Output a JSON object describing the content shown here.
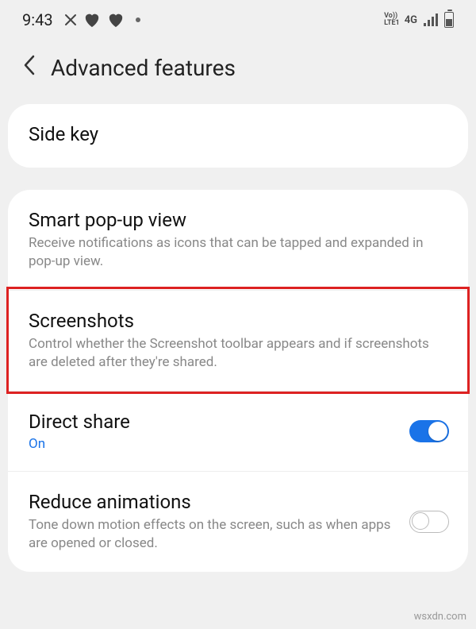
{
  "status": {
    "time": "9:43",
    "volte_top": "Vo))",
    "volte_bottom": "LTE1",
    "net": "4G"
  },
  "header": {
    "title": "Advanced features"
  },
  "card1": {
    "side_key": {
      "title": "Side key"
    }
  },
  "card2": {
    "smart_popup": {
      "title": "Smart pop-up view",
      "desc": "Receive notifications as icons that can be tapped and expanded in pop-up view."
    },
    "screenshots": {
      "title": "Screenshots",
      "desc": "Control whether the Screenshot toolbar appears and if screenshots are deleted after they're shared."
    },
    "direct_share": {
      "title": "Direct share",
      "status": "On"
    },
    "reduce_animations": {
      "title": "Reduce animations",
      "desc": "Tone down motion effects on the screen, such as when apps are opened or closed."
    }
  },
  "watermark": "wsxdn.com"
}
